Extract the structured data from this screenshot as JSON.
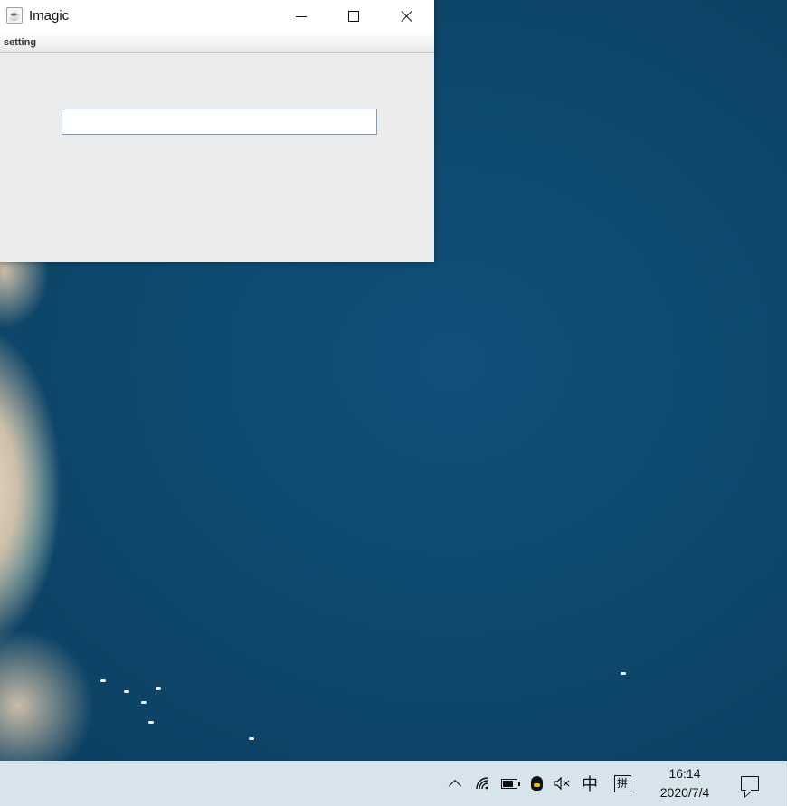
{
  "window": {
    "title": "Imagic",
    "icon": "java-cup-icon",
    "menu": {
      "items": [
        {
          "label": "setting"
        }
      ]
    },
    "text_field": {
      "value": ""
    },
    "controls": [
      "minimize-icon",
      "maximize-icon",
      "close-icon"
    ]
  },
  "taskbar": {
    "tray_icons": [
      "chevron-up-icon",
      "wifi-icon",
      "battery-icon",
      "qq-icon",
      "speaker-muted-icon"
    ],
    "ime_mode": "中",
    "ime_layout": "拼",
    "time": "16:14",
    "date": "2020/7/4",
    "notification_icon": "action-center-icon"
  },
  "colors": {
    "window_bg": "#ececec",
    "taskbar_bg": "#d7e4ec",
    "wallpaper_sea": "#0f4a6e"
  }
}
